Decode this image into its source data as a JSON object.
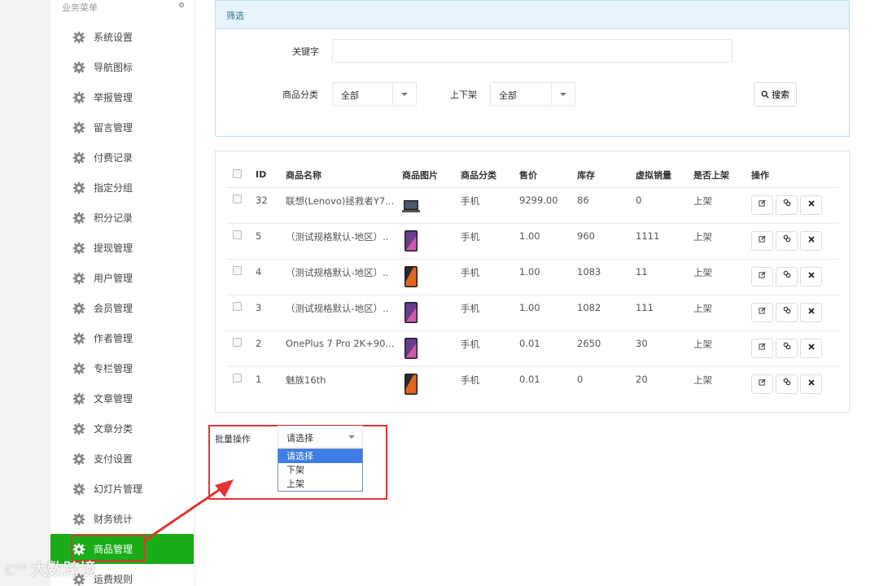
{
  "sidebar": {
    "header": "业务菜单",
    "items": [
      {
        "label": "系统设置"
      },
      {
        "label": "导航图标"
      },
      {
        "label": "举报管理"
      },
      {
        "label": "留言管理"
      },
      {
        "label": "付费记录"
      },
      {
        "label": "指定分组"
      },
      {
        "label": "积分记录"
      },
      {
        "label": "提现管理"
      },
      {
        "label": "用户管理"
      },
      {
        "label": "会员管理"
      },
      {
        "label": "作者管理"
      },
      {
        "label": "专栏管理"
      },
      {
        "label": "文章管理"
      },
      {
        "label": "文章分类"
      },
      {
        "label": "支付设置"
      },
      {
        "label": "幻灯片管理"
      },
      {
        "label": "财务统计"
      },
      {
        "label": "商品管理",
        "active": true
      },
      {
        "label": "运费规则"
      }
    ]
  },
  "filter": {
    "title": "筛选",
    "keyword_label": "关键字",
    "keyword_value": "",
    "category_label": "商品分类",
    "category_value": "全部",
    "shelf_label": "上下架",
    "shelf_value": "全部",
    "search_button": "搜索"
  },
  "table": {
    "headers": [
      "ID",
      "商品名称",
      "商品图片",
      "商品分类",
      "售价",
      "库存",
      "虚拟销量",
      "是否上架",
      "操作"
    ],
    "rows": [
      {
        "id": "32",
        "name": "联想(Lenovo)拯救者Y7...",
        "category": "手机",
        "price": "9299.00",
        "stock": "86",
        "virtual_sales": "0",
        "on_shelf": "上架",
        "thumb": "laptop"
      },
      {
        "id": "5",
        "name": "（测试规格默认-地区）..",
        "category": "手机",
        "price": "1.00",
        "stock": "960",
        "virtual_sales": "1111",
        "on_shelf": "上架",
        "thumb": "phone-purple"
      },
      {
        "id": "4",
        "name": "（测试规格默认-地区）..",
        "category": "手机",
        "price": "1.00",
        "stock": "1083",
        "virtual_sales": "11",
        "on_shelf": "上架",
        "thumb": "phone-orange"
      },
      {
        "id": "3",
        "name": "（测试规格默认-地区）..",
        "category": "手机",
        "price": "1.00",
        "stock": "1082",
        "virtual_sales": "111",
        "on_shelf": "上架",
        "thumb": "phone-purple"
      },
      {
        "id": "2",
        "name": "OnePlus 7 Pro 2K+90...",
        "category": "手机",
        "price": "0.01",
        "stock": "2650",
        "virtual_sales": "30",
        "on_shelf": "上架",
        "thumb": "phone-purple"
      },
      {
        "id": "1",
        "name": "魅族16th",
        "category": "手机",
        "price": "0.01",
        "stock": "0",
        "virtual_sales": "20",
        "on_shelf": "上架",
        "thumb": "phone-orange"
      }
    ],
    "actions": [
      "edit-icon",
      "link-icon",
      "delete-icon"
    ]
  },
  "batch": {
    "label": "批量操作",
    "selected": "请选择",
    "options": [
      "请选择",
      "下架",
      "上架"
    ]
  },
  "watermark": {
    "text": "大数跨境",
    "logo": "ℂ°°"
  },
  "colors": {
    "active_menu": "#1aad19",
    "highlight": "#e53333",
    "filter_header_bg": "#e8f4fb",
    "dropdown_selected": "#3d7de4"
  }
}
